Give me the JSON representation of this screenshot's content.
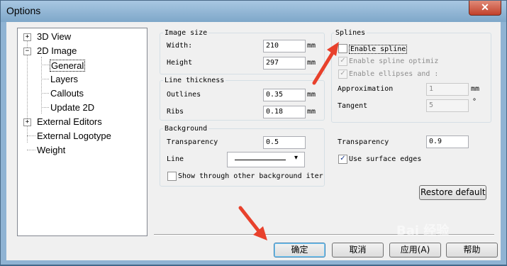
{
  "window": {
    "title": "Options",
    "close_glyph": "✕"
  },
  "tree": {
    "items": [
      {
        "label": "3D View",
        "expander": "+"
      },
      {
        "label": "2D Image",
        "expander": "−"
      },
      {
        "label": "General"
      },
      {
        "label": "Layers"
      },
      {
        "label": "Callouts"
      },
      {
        "label": "Update 2D"
      },
      {
        "label": "External Editors",
        "expander": "+"
      },
      {
        "label": "External Logotype"
      },
      {
        "label": "Weight"
      }
    ]
  },
  "image_size": {
    "title": "Image size",
    "width_label": "Width:",
    "width_value": "210",
    "height_label": "Height",
    "height_value": "297",
    "unit": "mm"
  },
  "line_thickness": {
    "title": "Line thickness",
    "outlines_label": "Outlines",
    "outlines_value": "0.35",
    "ribs_label": "Ribs",
    "ribs_value": "0.18",
    "unit": "mm"
  },
  "background": {
    "title": "Background",
    "transparency_label": "Transparency",
    "transparency_value": "0.5",
    "line_label": "Line",
    "show_through_label": "Show through other background iter"
  },
  "splines": {
    "title": "Splines",
    "enable_spline": "Enable spline",
    "enable_spline_opt": "Enable spline optimiz",
    "enable_ellipses": "Enable ellipses and :",
    "approximation_label": "Approximation",
    "approximation_value": "1",
    "approximation_unit": "mm",
    "tangent_label": "Tangent",
    "tangent_value": "5",
    "tangent_unit": "°"
  },
  "surface": {
    "transparency_label": "Transparency",
    "transparency_value": "0.9",
    "use_surface_edges": "Use surface edges"
  },
  "restore_defaults": "Restore defaults",
  "buttons": {
    "ok": "确定",
    "cancel": "取消",
    "apply": "应用(A)",
    "help": "帮助"
  },
  "watermark": "Bai 经验",
  "colors": {
    "arrow": "#e8412c",
    "window_frame": "#8fb3d3"
  }
}
